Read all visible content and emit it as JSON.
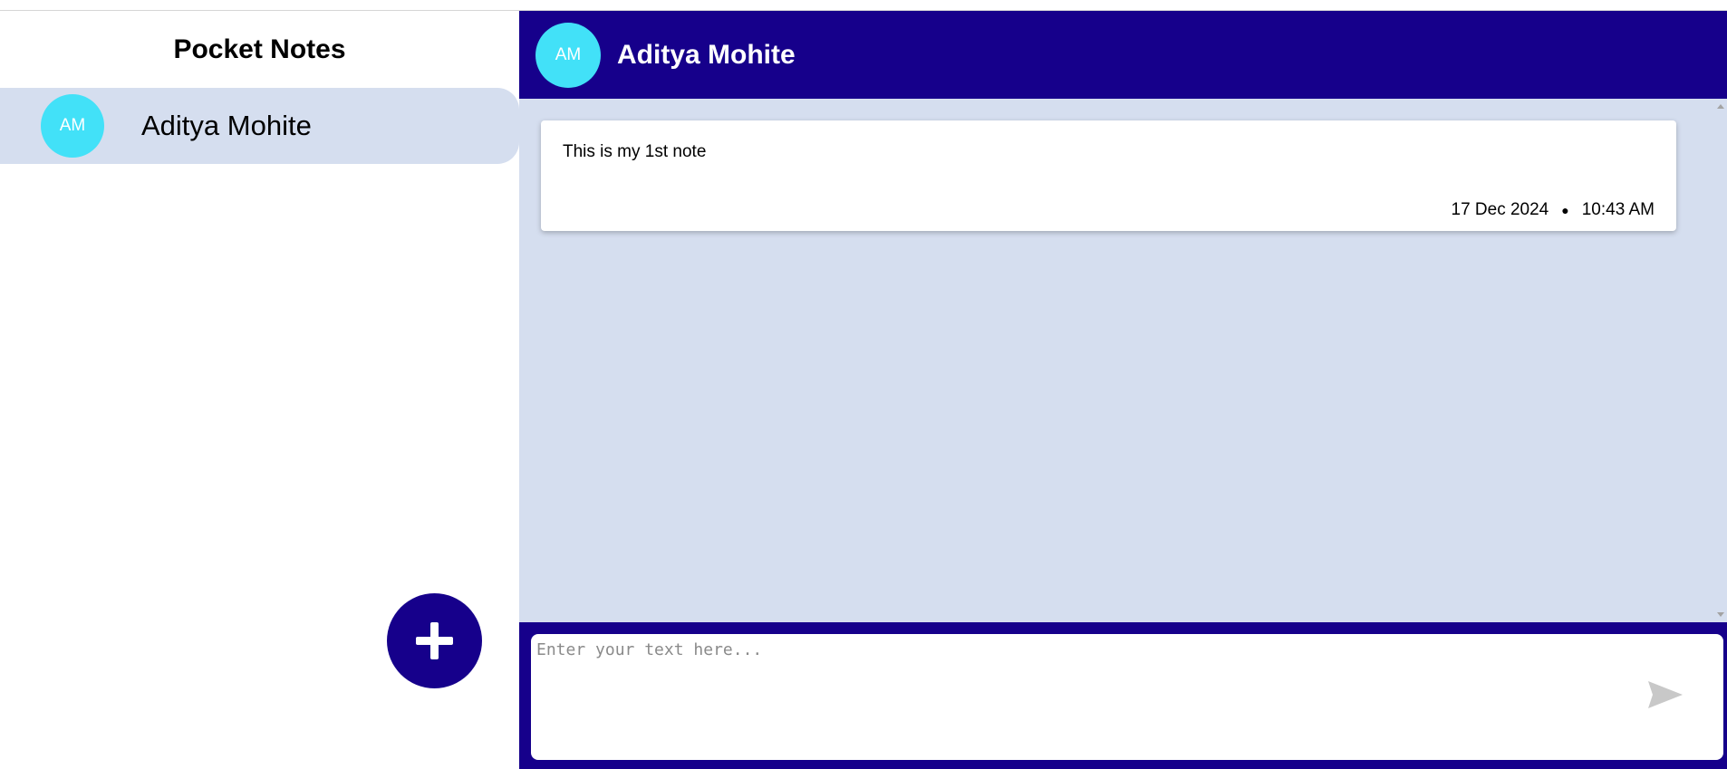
{
  "sidebar": {
    "title": "Pocket Notes",
    "groups": [
      {
        "initials": "AM",
        "name": "Aditya Mohite"
      }
    ],
    "add_button_icon": "plus-icon"
  },
  "header": {
    "initials": "AM",
    "title": "Aditya Mohite"
  },
  "notes": [
    {
      "text": "This is my 1st note",
      "date": "17 Dec 2024",
      "separator": "●",
      "time": "10:43 AM"
    }
  ],
  "composer": {
    "placeholder": "Enter your text here...",
    "send_icon": "send-icon"
  },
  "colors": {
    "primary": "#16008b",
    "avatar": "#42e1f8",
    "panel": "#d5deef"
  }
}
